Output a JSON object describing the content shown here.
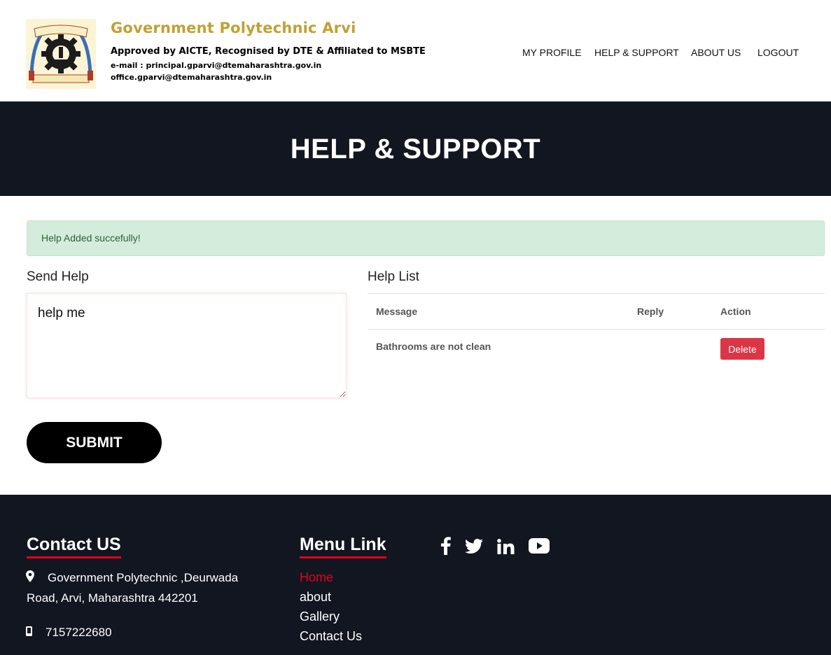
{
  "header": {
    "title": "Government Polytechnic Arvi",
    "subtitle": "Approved by AICTE, Recognised by DTE & Affiliated to MSBTE",
    "email_line1": "e-mail : principal.gparvi@dtemaharashtra.gov.in",
    "email_line2": "office.gparvi@dtemaharashtra.gov.in",
    "nav": [
      "MY PROFILE",
      "HELP & SUPPORT",
      "ABOUT US",
      "LOGOUT"
    ]
  },
  "banner": {
    "title": "HELP & SUPPORT"
  },
  "alert": {
    "text": "Help Added succefully!"
  },
  "send_help": {
    "title": "Send Help",
    "textarea_value": "help me",
    "submit_label": "SUBMIT"
  },
  "help_list": {
    "title": "Help List",
    "columns": [
      "Message",
      "Reply",
      "Action"
    ],
    "rows": [
      {
        "message": "Bathrooms are not clean",
        "reply": "",
        "action_label": "Delete"
      }
    ]
  },
  "footer": {
    "contact_heading": "Contact US",
    "address_line1": "Government Polytechnic ,Deurwada",
    "address_line2": "Road, Arvi, Maharashtra 442201",
    "phone": "7157222680",
    "menu_heading": "Menu Link",
    "menu_links": [
      "Home",
      "about",
      "Gallery",
      "Contact Us"
    ],
    "social_icons": [
      "facebook-icon",
      "twitter-icon",
      "linkedin-icon",
      "youtube-icon"
    ]
  },
  "colors": {
    "brand_gold": "#c1a135",
    "dark_bg": "#121621",
    "accent_red": "#e3001b",
    "alert_bg": "#d4ecdb",
    "delete_red": "#dc3545"
  }
}
